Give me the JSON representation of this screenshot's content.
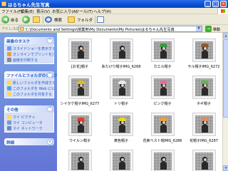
{
  "window": {
    "title": "はるちゃん先生写真"
  },
  "menu": {
    "items": [
      "ファイル(F)",
      "編集(E)",
      "表示(V)",
      "お気に入り(A)",
      "ツール(T)",
      "ヘルプ(H)"
    ]
  },
  "toolbar": {
    "back_label": "戻る",
    "search_label": "検索",
    "folders_label": "フォルダ"
  },
  "address": {
    "label": "アドレス(D)",
    "path": "C:\\Documents and Settings\\授業用\\My Documents\\My Pictures\\はるちゃん先生写真",
    "go_label": "移動"
  },
  "left_panels": [
    {
      "title": "画像のタスク",
      "links": [
        "スライドショーを表示する",
        "オンラインでプリントを注文する",
        "画像を印刷する"
      ]
    },
    {
      "title": "ファイルとフォルダのタスク",
      "links": [
        "新しいフォルダを作成する",
        "このフォルダを Web に公開する",
        "このフォルダを共有する"
      ]
    },
    {
      "title": "その他",
      "links": [
        "マイ ピクチャ",
        "マイ コンピュータ",
        "マイ ネットワーク"
      ]
    },
    {
      "title": "詳細",
      "links": []
    }
  ],
  "photos": [
    {
      "caption": "[お花]帽子",
      "hat_color": ""
    },
    {
      "caption": "あたけり帽子IMG_6268",
      "hat_color": ""
    },
    {
      "caption": "カエル帽子",
      "hat_color": "#3a9a3a"
    },
    {
      "caption": "サル帽子IMG_6272",
      "hat_color": "#8a5a30"
    },
    {
      "caption": "シイタケ帽子IMG_6277",
      "hat_color": "#d8c020"
    },
    {
      "caption": "トリ帽子",
      "hat_color": "#e8e8e8"
    },
    {
      "caption": "ピンク帽子",
      "hat_color": "#e86aa0"
    },
    {
      "caption": "ネギ帽子",
      "hat_color": "#5ab84a"
    },
    {
      "caption": "ウイルン帽子",
      "hat_color": "#d84030"
    },
    {
      "caption": "黄色帽子",
      "hat_color": "#e8d820"
    },
    {
      "caption": "花束ベスト帽IMG_6286",
      "hat_color": "#e8a040"
    },
    {
      "caption": "花帽子IMG_6287",
      "hat_color": "#d89060"
    },
    {
      "caption": "",
      "hat_color": ""
    },
    {
      "caption": "",
      "hat_color": ""
    },
    {
      "caption": "",
      "hat_color": ""
    },
    {
      "caption": "",
      "hat_color": ""
    }
  ]
}
